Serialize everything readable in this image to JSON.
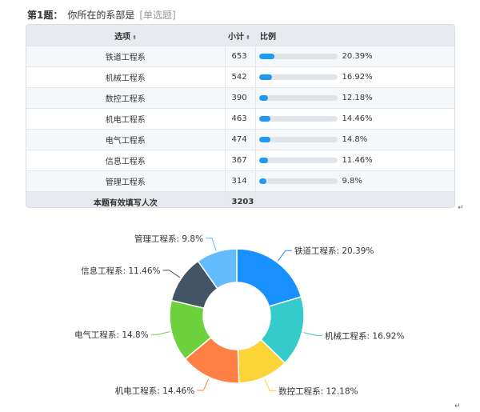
{
  "question": {
    "number_label": "第1题：",
    "text": "你所在的系部是",
    "type_tag": "[单选题]"
  },
  "table": {
    "headers": {
      "option": "选项",
      "count": "小计",
      "ratio": "比例"
    },
    "sort_icon": "sort-icon",
    "rows": [
      {
        "option": "铁道工程系",
        "count": "653",
        "percent_text": "20.39%",
        "percent": 20.39
      },
      {
        "option": "机械工程系",
        "count": "542",
        "percent_text": "16.92%",
        "percent": 16.92
      },
      {
        "option": "数控工程系",
        "count": "390",
        "percent_text": "12.18%",
        "percent": 12.18
      },
      {
        "option": "机电工程系",
        "count": "463",
        "percent_text": "14.46%",
        "percent": 14.46
      },
      {
        "option": "电气工程系",
        "count": "474",
        "percent_text": "14.8%",
        "percent": 14.8
      },
      {
        "option": "信息工程系",
        "count": "367",
        "percent_text": "11.46%",
        "percent": 11.46
      },
      {
        "option": "管理工程系",
        "count": "314",
        "percent_text": "9.8%",
        "percent": 9.8
      }
    ],
    "footer": {
      "label": "本题有效填写人次",
      "total": "3203"
    },
    "bar_color": "#1e9bf0"
  },
  "paragraph_mark": "↵",
  "chart_data": {
    "type": "pie",
    "donut": true,
    "categories": [
      "铁道工程系",
      "机械工程系",
      "数控工程系",
      "机电工程系",
      "电气工程系",
      "信息工程系",
      "管理工程系"
    ],
    "values": [
      20.39,
      16.92,
      12.18,
      14.46,
      14.8,
      11.46,
      9.8
    ],
    "labels": [
      "铁道工程系: 20.39%",
      "机械工程系: 16.92%",
      "数控工程系: 12.18%",
      "机电工程系: 14.46%",
      "电气工程系: 14.8%",
      "信息工程系: 11.46%",
      "管理工程系: 9.8%"
    ],
    "colors": [
      "#1890ff",
      "#36cbcb",
      "#fbd437",
      "#ff7f45",
      "#6dd13e",
      "#435465",
      "#64bbfb"
    ]
  }
}
